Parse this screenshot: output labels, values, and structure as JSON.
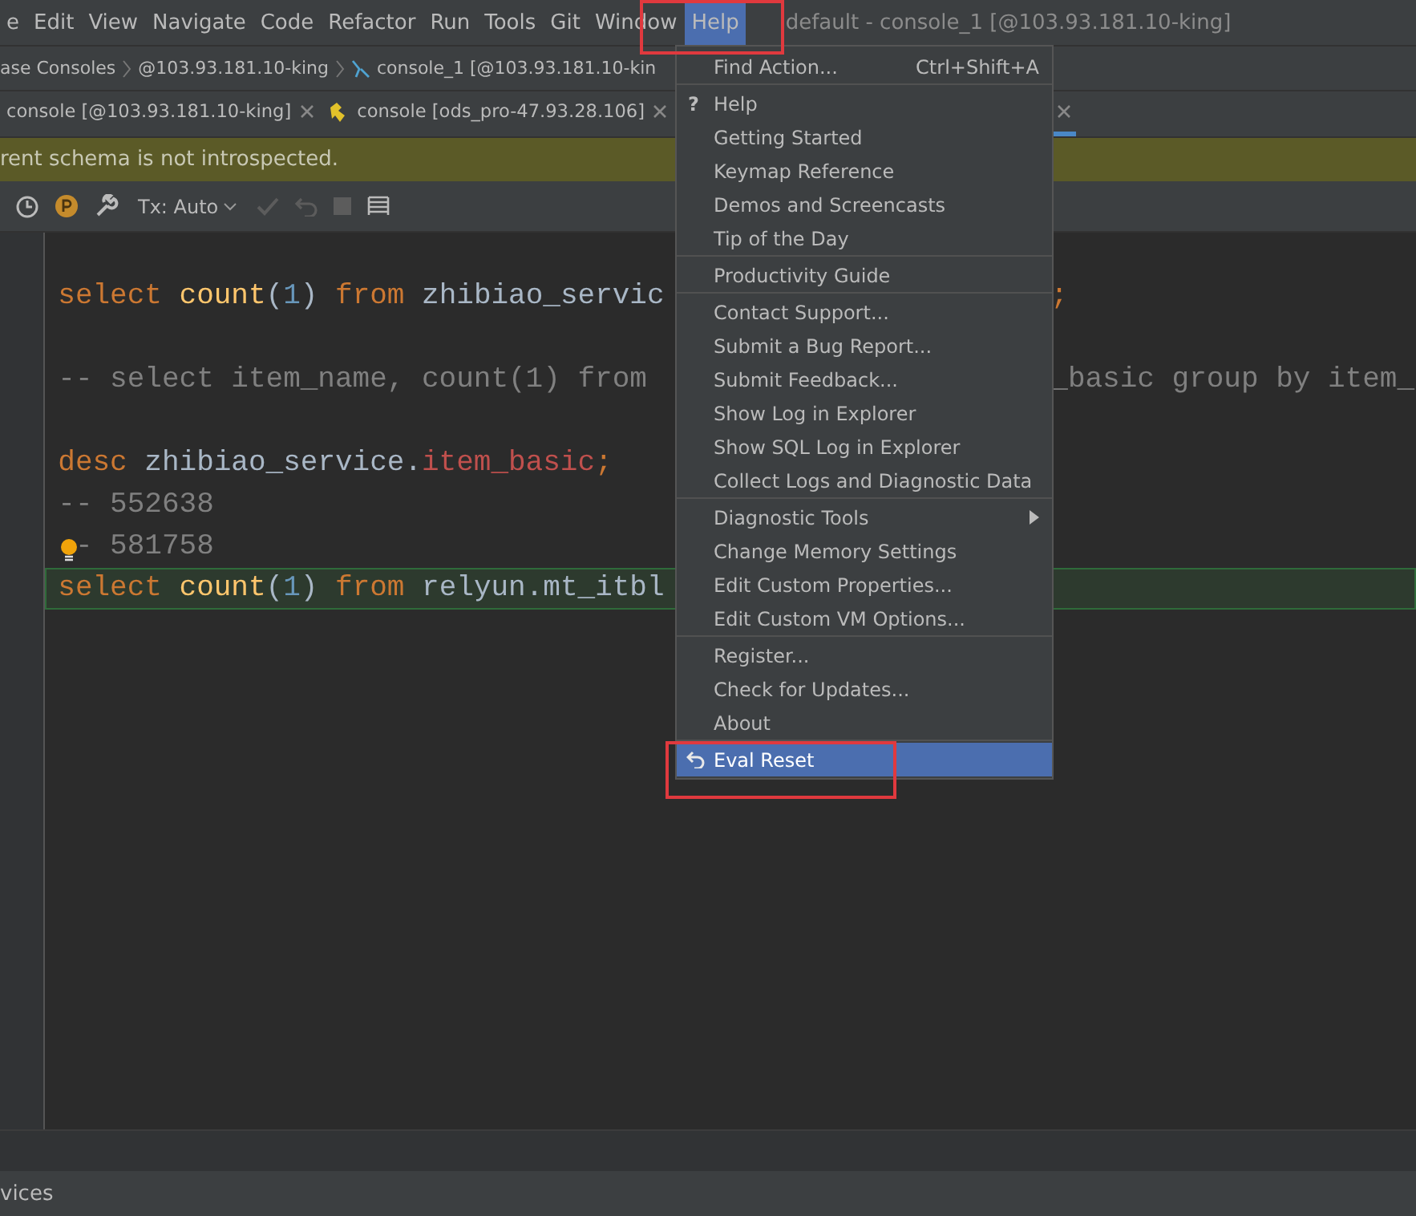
{
  "menubar": {
    "items": [
      {
        "label": "e",
        "selected": false
      },
      {
        "label": "Edit",
        "selected": false
      },
      {
        "label": "View",
        "selected": false
      },
      {
        "label": "Navigate",
        "selected": false
      },
      {
        "label": "Code",
        "selected": false
      },
      {
        "label": "Refactor",
        "selected": false
      },
      {
        "label": "Run",
        "selected": false
      },
      {
        "label": "Tools",
        "selected": false
      },
      {
        "label": "Git",
        "selected": false
      },
      {
        "label": "Window",
        "selected": false
      },
      {
        "label": "Help",
        "selected": true
      }
    ],
    "title": "default - console_1 [@103.93.181.10-king]"
  },
  "breadcrumbs": [
    {
      "label": "ase Consoles",
      "kind": "text"
    },
    {
      "label": "@103.93.181.10-king",
      "kind": "text"
    },
    {
      "label": "console_1 [@103.93.181.10-kin",
      "kind": "console"
    }
  ],
  "tabs": [
    {
      "label": "console [@103.93.181.10-king]",
      "kind": "plain",
      "selected": false
    },
    {
      "label": "console [ods_pro-47.93.28.106]",
      "kind": "pro",
      "selected": false
    },
    {
      "kind": "covered",
      "selected": true
    }
  ],
  "warning": "rent schema is not introspected.",
  "toolbar": {
    "tx_mode": "Tx: Auto"
  },
  "editor": {
    "lines": [
      {
        "kind": "blank"
      },
      {
        "kind": "code",
        "left": [
          {
            "text": "select ",
            "kind": "keyword"
          },
          {
            "text": "count",
            "kind": "function"
          },
          {
            "text": "(",
            "kind": "plain"
          },
          {
            "text": "1",
            "kind": "number"
          },
          {
            "text": ") ",
            "kind": "plain"
          },
          {
            "text": "from ",
            "kind": "keyword"
          },
          {
            "text": "zhibiao_servic",
            "kind": "plain"
          }
        ],
        "right": [
          {
            "text": ";",
            "kind": "keyword"
          }
        ]
      },
      {
        "kind": "blank"
      },
      {
        "kind": "code",
        "left": [
          {
            "text": "-- select item_name, count(1) from ",
            "kind": "comment"
          }
        ],
        "right": [
          {
            "text": "_basic group by item_",
            "kind": "comment"
          }
        ]
      },
      {
        "kind": "blank"
      },
      {
        "kind": "code",
        "left": [
          {
            "text": "desc ",
            "kind": "keyword"
          },
          {
            "text": "zhibiao_service.",
            "kind": "plain"
          },
          {
            "text": "item_basic",
            "kind": "column"
          },
          {
            "text": ";",
            "kind": "keyword"
          }
        ]
      },
      {
        "kind": "code",
        "left": [
          {
            "text": "-- 552638",
            "kind": "comment"
          }
        ]
      },
      {
        "kind": "code",
        "left": [
          {
            "text": "-- 581758",
            "kind": "comment"
          }
        ],
        "bulb": true
      },
      {
        "kind": "code",
        "left": [
          {
            "text": "select ",
            "kind": "keyword"
          },
          {
            "text": "count",
            "kind": "function"
          },
          {
            "text": "(",
            "kind": "plain"
          },
          {
            "text": "1",
            "kind": "number"
          },
          {
            "text": ") ",
            "kind": "plain"
          },
          {
            "text": "from ",
            "kind": "keyword"
          },
          {
            "text": "relyun.",
            "kind": "plain"
          },
          {
            "text": "mt_itbl",
            "kind": "plain"
          }
        ],
        "current": true
      }
    ]
  },
  "status_bar": "vices",
  "help_menu": {
    "groups": [
      [
        {
          "label": "Find Action...",
          "shortcut": "Ctrl+Shift+A",
          "selected": false
        }
      ],
      [
        {
          "label": "Help",
          "icon": "?",
          "selected": false
        },
        {
          "label": "Getting Started",
          "selected": false
        },
        {
          "label": "Keymap Reference",
          "selected": false
        },
        {
          "label": "Demos and Screencasts",
          "selected": false
        },
        {
          "label": "Tip of the Day",
          "selected": false
        }
      ],
      [
        {
          "label": "Productivity Guide",
          "selected": false
        }
      ],
      [
        {
          "label": "Contact Support...",
          "selected": false
        },
        {
          "label": "Submit a Bug Report...",
          "selected": false
        },
        {
          "label": "Submit Feedback...",
          "selected": false
        },
        {
          "label": "Show Log in Explorer",
          "selected": false
        },
        {
          "label": "Show SQL Log in Explorer",
          "selected": false
        },
        {
          "label": "Collect Logs and Diagnostic Data",
          "selected": false
        }
      ],
      [
        {
          "label": "Diagnostic Tools",
          "submenu": true,
          "selected": false
        },
        {
          "label": "Change Memory Settings",
          "selected": false
        },
        {
          "label": "Edit Custom Properties...",
          "selected": false
        },
        {
          "label": "Edit Custom VM Options...",
          "selected": false
        }
      ],
      [
        {
          "label": "Register...",
          "selected": false
        },
        {
          "label": "Check for Updates...",
          "selected": false
        },
        {
          "label": "About",
          "selected": false
        }
      ],
      [
        {
          "label": "Eval Reset",
          "kind": "reset",
          "selected": true
        }
      ]
    ]
  }
}
